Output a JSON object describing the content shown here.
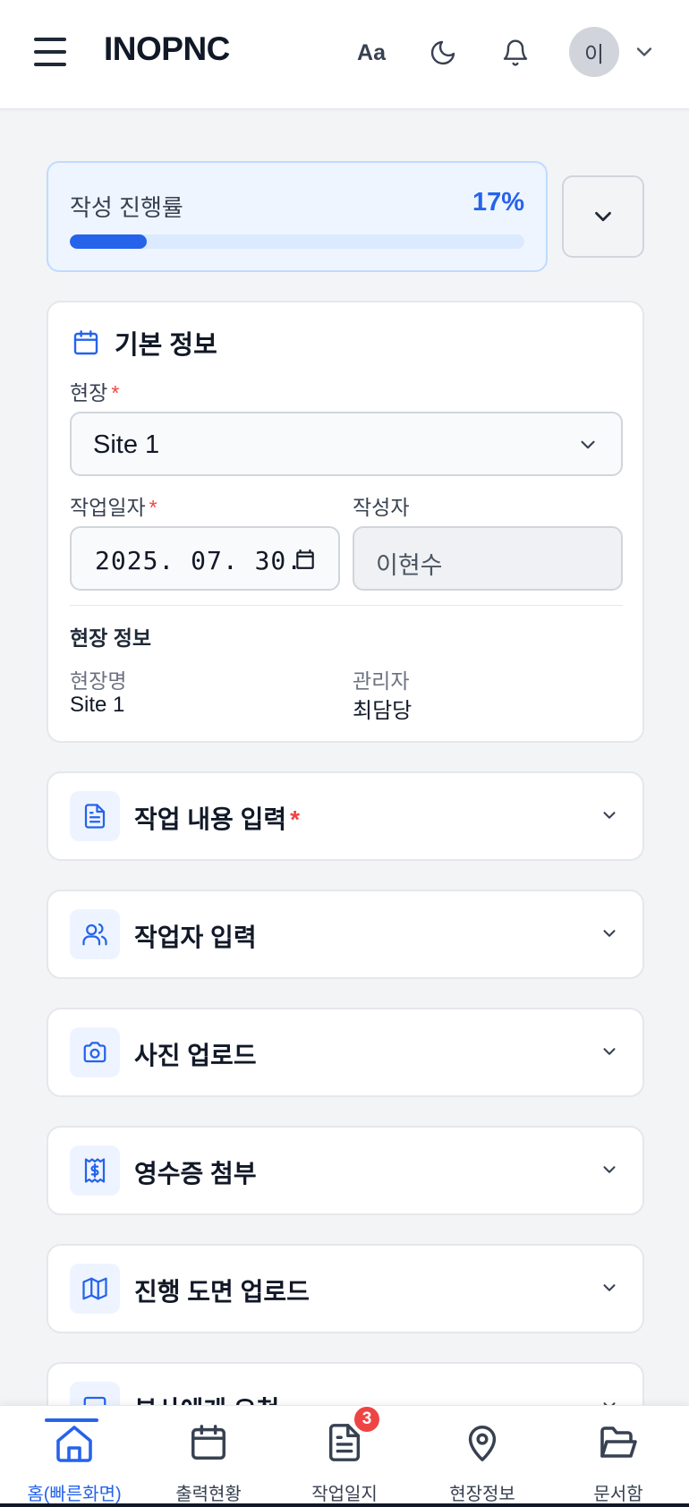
{
  "header": {
    "brand": "INOPNC",
    "font_button": "Aa",
    "avatar_initial": "이"
  },
  "progress": {
    "label": "작성 진행률",
    "percent_text": "17%",
    "value": 0.17
  },
  "basic_info": {
    "title": "기본 정보",
    "site_label": "현장",
    "site_value": "Site 1",
    "date_label": "작업일자",
    "date_value": "2025. 07. 30.",
    "author_label": "작성자",
    "author_value": "이현수",
    "site_info_title": "현장 정보",
    "site_name_label": "현장명",
    "site_name_value": "Site 1",
    "manager_label": "관리자",
    "manager_value": "최담당"
  },
  "sections": [
    {
      "title": "작업 내용 입력",
      "required": true,
      "icon": "document-icon"
    },
    {
      "title": "작업자 입력",
      "required": false,
      "icon": "users-icon"
    },
    {
      "title": "사진 업로드",
      "required": false,
      "icon": "camera-icon"
    },
    {
      "title": "영수증 첨부",
      "required": false,
      "icon": "receipt-icon"
    },
    {
      "title": "진행 도면 업로드",
      "required": false,
      "icon": "map-icon"
    },
    {
      "title": "본사에게 요청",
      "required": false,
      "icon": "message-icon"
    }
  ],
  "required_mark": "*",
  "bottom_nav": {
    "items": [
      {
        "label": "홈(빠른화면)",
        "icon": "home-icon",
        "active": true
      },
      {
        "label": "출력현황",
        "icon": "calendar-icon",
        "active": false
      },
      {
        "label": "작업일지",
        "icon": "document-icon",
        "active": false
      },
      {
        "label": "현장정보",
        "icon": "map-pin-icon",
        "active": false
      },
      {
        "label": "문서함",
        "icon": "folder-icon",
        "active": false
      }
    ],
    "badge_count": "3"
  },
  "colors": {
    "accent": "#2563eb",
    "required": "#ef4444",
    "badge": "#ef4444"
  }
}
